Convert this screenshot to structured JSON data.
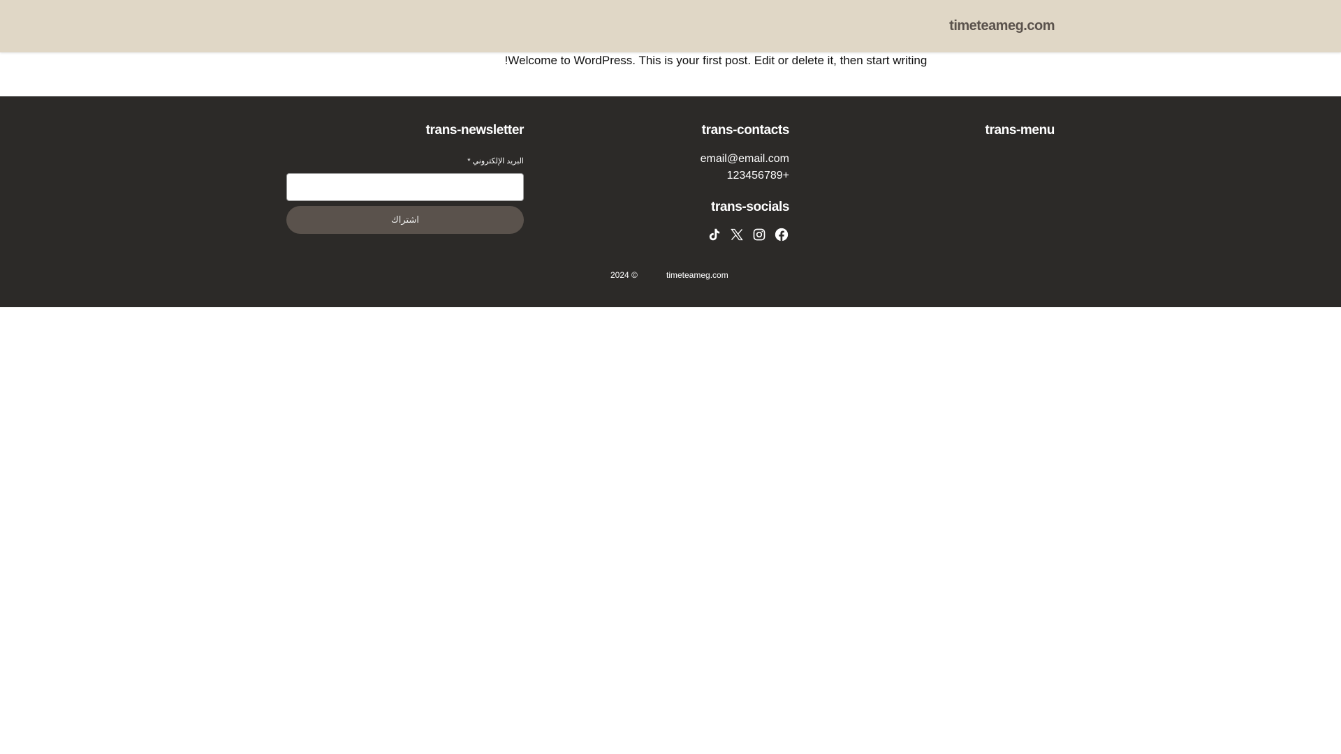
{
  "header": {
    "site_title": "timeteameg.com"
  },
  "post": {
    "text": "!Welcome to WordPress. This is your first post. Edit or delete it, then start writing"
  },
  "footer": {
    "newsletter": {
      "heading": "trans-newsletter",
      "email_label": "البريد الإلكتروني *",
      "email_value": "",
      "subscribe_label": "اشتراك"
    },
    "contacts": {
      "heading": "trans-contacts",
      "email": "email@email.com",
      "phone": "123456789+"
    },
    "socials": {
      "heading": "trans-socials",
      "icons": [
        "tiktok-icon",
        "x-icon",
        "instagram-icon",
        "facebook-icon"
      ]
    },
    "menu": {
      "heading": "trans-menu"
    },
    "copyright": {
      "year": "2024 ©",
      "site": "timeteameg.com"
    }
  },
  "colors": {
    "header_bg": "#e0d7c6",
    "footer_bg": "#2c2a28",
    "button_bg": "#5a524c"
  }
}
